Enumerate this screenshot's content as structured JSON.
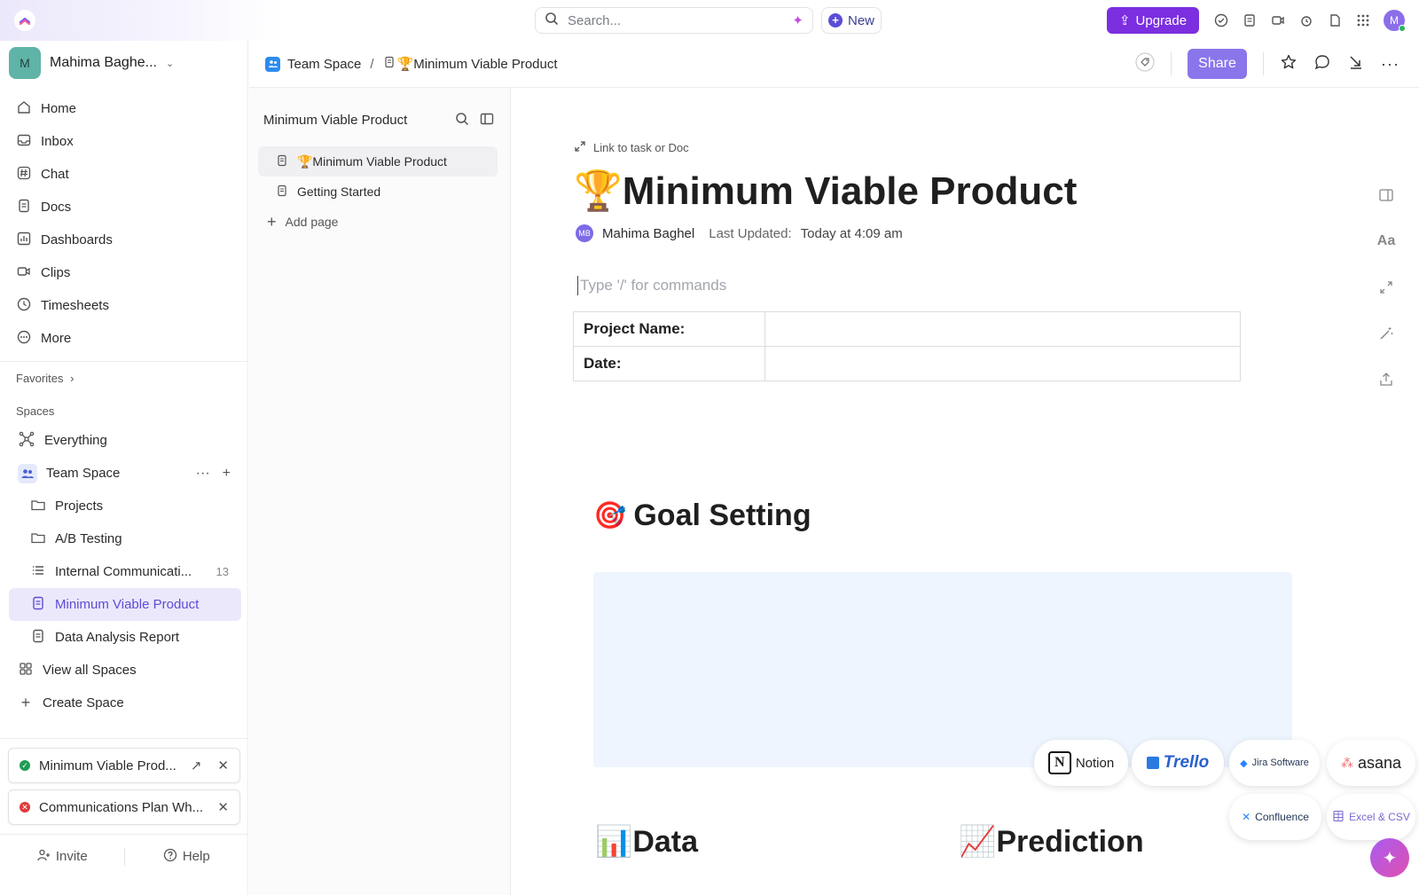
{
  "search": {
    "placeholder": "Search..."
  },
  "topbar": {
    "new_label": "New",
    "upgrade_label": "Upgrade",
    "avatar_initial": "M"
  },
  "workspace": {
    "initial": "M",
    "name": "Mahima Baghe..."
  },
  "nav": [
    {
      "label": "Home"
    },
    {
      "label": "Inbox"
    },
    {
      "label": "Chat"
    },
    {
      "label": "Docs"
    },
    {
      "label": "Dashboards"
    },
    {
      "label": "Clips"
    },
    {
      "label": "Timesheets"
    },
    {
      "label": "More"
    }
  ],
  "sections": {
    "favorites": "Favorites",
    "spaces": "Spaces"
  },
  "spaces": {
    "everything": "Everything",
    "team_space": "Team Space",
    "projects": "Projects",
    "ab_testing": "A/B Testing",
    "internal_comm": "Internal Communicati...",
    "internal_comm_count": "13",
    "mvp": "Minimum Viable Product",
    "data_report": "Data Analysis Report",
    "view_all": "View all Spaces",
    "create": "Create Space"
  },
  "recent": [
    {
      "label": "Minimum Viable Prod...",
      "status_color": "#1f9d55"
    },
    {
      "label": "Communications Plan Wh...",
      "status_color": "#e03a3a"
    }
  ],
  "bottom": {
    "invite": "Invite",
    "help": "Help"
  },
  "breadcrumb": {
    "space": "Team Space",
    "separator": "/",
    "doc": "🏆Minimum Viable Product"
  },
  "header": {
    "share_label": "Share"
  },
  "pages_panel": {
    "title": "Minimum Viable Product",
    "pages": [
      "🏆Minimum Viable Product",
      "Getting Started"
    ],
    "add_page": "Add page"
  },
  "doc": {
    "link_task": "Link to task or Doc",
    "title": "🏆Minimum Viable Product",
    "author_initials": "MB",
    "author": "Mahima Baghel",
    "last_updated_label": "Last Updated:",
    "last_updated": "Today at 4:09 am",
    "command_placeholder": "Type '/' for commands",
    "table": [
      {
        "key": "Project Name:",
        "value": ""
      },
      {
        "key": "Date:",
        "value": ""
      }
    ],
    "goal_heading": "Goal Setting",
    "goal_emoji": "🎯",
    "data_heading": "📊Data",
    "prediction_heading": "📈Prediction",
    "font_tool_label": "Aa"
  },
  "integrations": [
    "Notion",
    "Trello",
    "Jira Software",
    "asana",
    "Confluence",
    "Excel & CSV"
  ]
}
